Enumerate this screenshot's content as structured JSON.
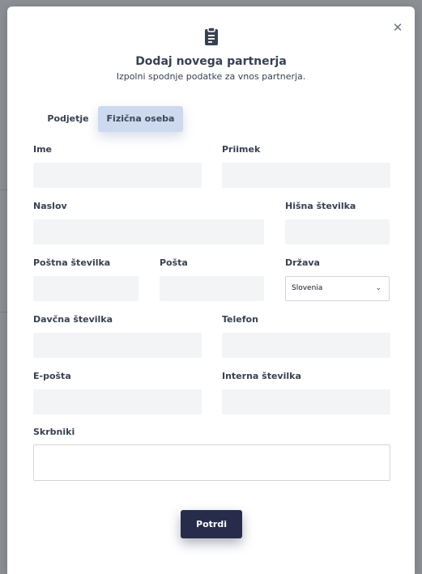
{
  "modal": {
    "icon": "clipboard-icon",
    "title": "Dodaj novega partnerja",
    "subtitle": "Izpolni spodnje podatke za vnos partnerja.",
    "close_label": "✕"
  },
  "tabs": [
    {
      "label": "Podjetje",
      "active": false
    },
    {
      "label": "Fizična oseba",
      "active": true
    }
  ],
  "form": {
    "first_name": {
      "label": "Ime",
      "value": ""
    },
    "last_name": {
      "label": "Priimek",
      "value": ""
    },
    "address": {
      "label": "Naslov",
      "value": ""
    },
    "house_number": {
      "label": "Hišna številka",
      "value": ""
    },
    "postal_code": {
      "label": "Poštna številka",
      "value": ""
    },
    "post": {
      "label": "Pošta",
      "value": ""
    },
    "country": {
      "label": "Država",
      "value": "Slovenia"
    },
    "tax_number": {
      "label": "Davčna številka",
      "value": ""
    },
    "phone": {
      "label": "Telefon",
      "value": ""
    },
    "email": {
      "label": "E-pošta",
      "value": ""
    },
    "internal_number": {
      "label": "Interna številka",
      "value": ""
    },
    "guardians": {
      "label": "Skrbniki",
      "value": ""
    }
  },
  "submit_label": "Potrdi",
  "colors": {
    "accent": "#262c4a",
    "active_tab": "#cdd9ef",
    "field_bg": "#f3f4f6"
  }
}
